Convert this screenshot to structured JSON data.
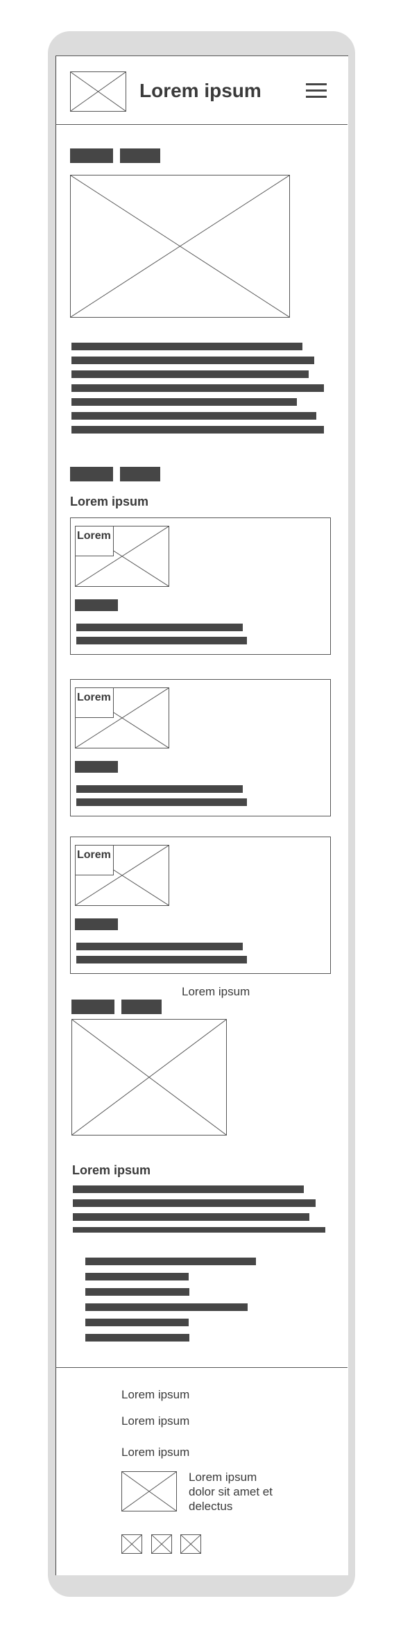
{
  "header": {
    "title": "Lorem ipsum",
    "logo_icon": "image-placeholder-icon",
    "menu_icon": "hamburger-menu-icon"
  },
  "section_1": {
    "tags": [
      "",
      ""
    ],
    "image_icon": "image-placeholder-icon"
  },
  "section_2": {
    "heading": "Lorem ipsum",
    "cards": [
      {
        "badge": "Lorem"
      },
      {
        "badge": "Lorem"
      },
      {
        "badge": "Lorem"
      }
    ]
  },
  "section_3": {
    "caption": "Lorem ipsum",
    "heading": "Lorem ipsum"
  },
  "footer": {
    "links": [
      "Lorem ipsum",
      "Lorem ipsum",
      "Lorem ipsum"
    ],
    "contact_text_line1": "Lorem ipsum",
    "contact_text_line2": "dolor sit amet et",
    "contact_text_line3": "delectus",
    "social_icons": [
      "image-placeholder-icon",
      "image-placeholder-icon",
      "image-placeholder-icon"
    ]
  },
  "colors": {
    "frame": "#dcdcdc",
    "bar": "#464646",
    "line": "#555555",
    "text": "#3a3a3a"
  }
}
